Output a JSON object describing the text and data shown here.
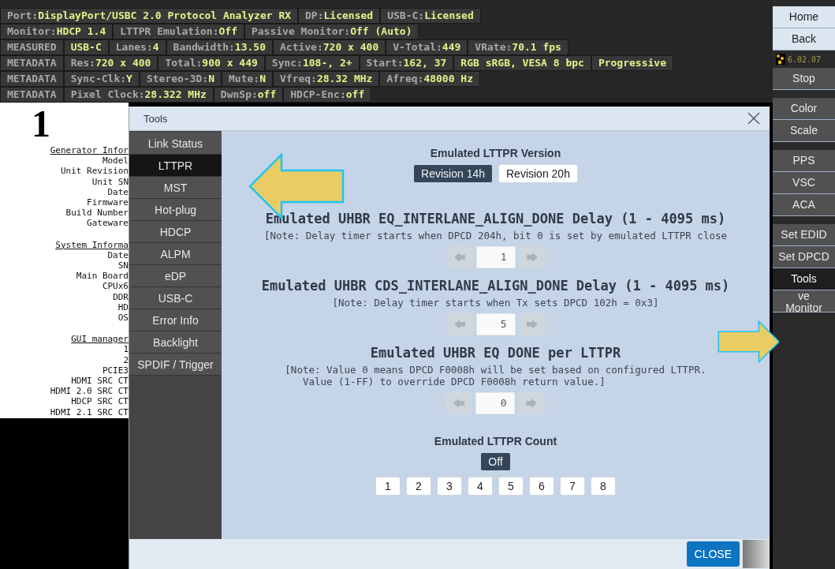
{
  "status_rows": [
    [
      {
        "label": "Port:",
        "value": "DisplayPort/USBC 2.0 Protocol Analyzer RX"
      },
      {
        "label": "DP:",
        "value": "Licensed"
      },
      {
        "label": "USB-C:",
        "value": "Licensed"
      }
    ],
    [
      {
        "label": "Monitor:",
        "value": "HDCP 1.4"
      },
      {
        "label": "LTTPR Emulation:",
        "value": "Off"
      },
      {
        "label": "Passive Monitor:",
        "value": "Off (Auto)"
      }
    ],
    [
      {
        "label": "MEASURED"
      },
      {
        "value": "USB-C"
      },
      {
        "label": "Lanes:",
        "value": "4"
      },
      {
        "label": "Bandwidth:",
        "value": "13.50"
      },
      {
        "label": "Active:",
        "value": "720 x 400"
      },
      {
        "label": "V-Total:",
        "value": "449"
      },
      {
        "label": "VRate:",
        "value": "70.1 fps"
      }
    ],
    [
      {
        "label": "METADATA"
      },
      {
        "label": "Res:",
        "value": "720 x 400"
      },
      {
        "label": "Total:",
        "value": "900 x 449"
      },
      {
        "label": "Sync:",
        "value": "108-, 2+"
      },
      {
        "label": "Start:",
        "value": "162, 37"
      },
      {
        "value": "RGB sRGB, VESA 8 bpc"
      },
      {
        "value": "Progressive"
      }
    ],
    [
      {
        "label": "METADATA"
      },
      {
        "label": "Sync-Clk:",
        "value": "Y"
      },
      {
        "label": "Stereo-3D:",
        "value": "N"
      },
      {
        "label": "Mute:",
        "value": "N"
      },
      {
        "label": "Vfreq:",
        "value": "28.32 MHz"
      },
      {
        "label": "Afreq:",
        "value": "48000 Hz"
      }
    ],
    [
      {
        "label": "METADATA"
      },
      {
        "label": "Pixel Clock:",
        "value": "28.322 MHz"
      },
      {
        "label": "DwnSp:",
        "value": "off"
      },
      {
        "label": "HDCP-Enc:",
        "value": "off"
      }
    ]
  ],
  "info_panel": {
    "big_label": "1",
    "lines": [
      {
        "text": "Generator Infor",
        "heading": true
      },
      {
        "text": "Model",
        "heading": false
      },
      {
        "text": "Unit Revision",
        "heading": false
      },
      {
        "text": "Unit SN",
        "heading": false
      },
      {
        "text": "Date",
        "heading": false
      },
      {
        "text": "Firmware",
        "heading": false
      },
      {
        "text": "Build Number",
        "heading": false
      },
      {
        "text": "Gateware",
        "heading": false
      },
      {
        "text": "System Informa",
        "heading": true
      },
      {
        "text": "Date",
        "heading": false
      },
      {
        "text": "SN",
        "heading": false
      },
      {
        "text": "Main Board",
        "heading": false
      },
      {
        "text": "CPUx6",
        "heading": false
      },
      {
        "text": "DDR",
        "heading": false
      },
      {
        "text": "HD",
        "heading": false
      },
      {
        "text": "OS",
        "heading": false
      },
      {
        "text": "GUI manager",
        "heading": true
      },
      {
        "text": "1",
        "heading": false
      },
      {
        "text": "2",
        "heading": false
      },
      {
        "text": "PCIE3",
        "heading": false
      },
      {
        "text": "HDMI SRC CT",
        "heading": false
      },
      {
        "text": "HDMI 2.0 SRC CT",
        "heading": false
      },
      {
        "text": "HDCP SRC CT",
        "heading": false
      },
      {
        "text": "HDMI 2.1 SRC CT",
        "heading": false
      }
    ]
  },
  "sidebar": {
    "groups": [
      [
        {
          "kind": "light",
          "label": "Home",
          "selected": false
        },
        {
          "kind": "light",
          "label": "Back",
          "selected": false
        },
        {
          "kind": "version",
          "label": "6.02.07"
        },
        {
          "kind": "button",
          "label": "Stop",
          "selected": false
        }
      ],
      [
        {
          "kind": "button",
          "label": "Color",
          "selected": false
        },
        {
          "kind": "button",
          "label": "Scale",
          "selected": false
        }
      ],
      [
        {
          "kind": "button",
          "label": "PPS",
          "selected": false
        },
        {
          "kind": "button",
          "label": "VSC",
          "selected": false
        },
        {
          "kind": "button",
          "label": "ACA",
          "selected": false
        }
      ],
      [
        {
          "kind": "button",
          "label": "Set EDID",
          "selected": false
        },
        {
          "kind": "button",
          "label": "Set DPCD",
          "selected": false
        },
        {
          "kind": "button",
          "label": "Tools",
          "selected": true
        },
        {
          "kind": "button",
          "label": "ve\nMonitor",
          "selected": false
        }
      ]
    ]
  },
  "dialog": {
    "title": "Tools",
    "nav": [
      {
        "label": "Link Status",
        "selected": false
      },
      {
        "label": "LTTPR",
        "selected": true
      },
      {
        "label": "MST",
        "selected": false
      },
      {
        "label": "Hot-plug",
        "selected": false
      },
      {
        "label": "HDCP",
        "selected": false
      },
      {
        "label": "ALPM",
        "selected": false
      },
      {
        "label": "eDP",
        "selected": false
      },
      {
        "label": "USB-C",
        "selected": false
      },
      {
        "label": "Error Info",
        "selected": false
      },
      {
        "label": "Backlight",
        "selected": false
      },
      {
        "label": "SPDIF / Trigger",
        "selected": false
      }
    ],
    "sections": [
      {
        "kind": "choice",
        "title": "Emulated LTTPR Version",
        "rows": [
          [
            {
              "label": "Revision 14h",
              "selected": true
            },
            {
              "label": "Revision 20h",
              "selected": false
            }
          ]
        ]
      },
      {
        "kind": "spinner",
        "title": "Emulated UHBR EQ_INTERLANE_ALIGN_DONE Delay (1 - 4095 ms)",
        "note": "[Note: Delay timer starts when DPCD 204h, bit 0 is set by emulated LTTPR close",
        "value": "1",
        "disabled": true
      },
      {
        "kind": "spinner",
        "title": "Emulated UHBR CDS_INTERLANE_ALIGN_DONE Delay (1 - 4095 ms)",
        "note": "[Note: Delay timer starts when Tx sets DPCD 102h = 0x3]",
        "value": "5",
        "disabled": true
      },
      {
        "kind": "spinner",
        "title": "Emulated UHBR EQ DONE per LTTPR",
        "note": "[Note: Value 0 means DPCD F0008h will be set based on configured LTTPR.\n   Value (1-FF) to override DPCD F0008h return value.]",
        "value": "0",
        "disabled": true
      },
      {
        "kind": "choice",
        "title": "Emulated LTTPR Count",
        "rows": [
          [
            {
              "label": "Off",
              "selected": true
            }
          ],
          [
            {
              "label": "1",
              "selected": false
            },
            {
              "label": "2",
              "selected": false
            },
            {
              "label": "3",
              "selected": false
            },
            {
              "label": "4",
              "selected": false
            },
            {
              "label": "5",
              "selected": false
            },
            {
              "label": "6",
              "selected": false
            },
            {
              "label": "7",
              "selected": false
            },
            {
              "label": "8",
              "selected": false
            }
          ]
        ]
      }
    ],
    "close_label": "CLOSE"
  }
}
